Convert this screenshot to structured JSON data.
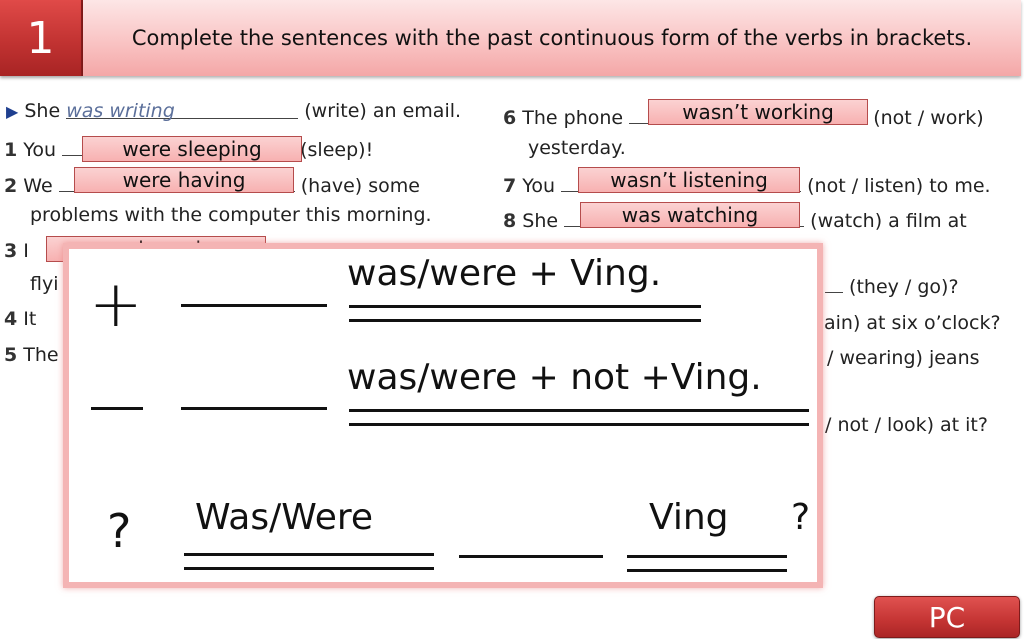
{
  "header": {
    "exercise_number": "1",
    "title": "Complete the sentences with the past continuous form of the verbs in brackets."
  },
  "exercise": {
    "example": {
      "prefix": "She",
      "answer": "was writing",
      "suffix": "(write) an email."
    },
    "items": [
      {
        "num": "1",
        "prefix": "You",
        "answer": "were sleeping",
        "suffix": "(sleep)!"
      },
      {
        "num": "2",
        "prefix": "We",
        "answer": "were having",
        "suffix": "(have) some",
        "line2": "problems with the computer this morning."
      },
      {
        "num": "3",
        "prefix": "I",
        "answer_partial": "was dreaming",
        "line2": "flyi"
      },
      {
        "num": "4",
        "prefix": "It"
      },
      {
        "num": "5",
        "prefix": "The"
      },
      {
        "num": "6",
        "prefix": "The phone",
        "answer": "wasn’t working",
        "suffix": "(not / work)",
        "line2": "yesterday."
      },
      {
        "num": "7",
        "prefix": "You",
        "answer": "wasn’t listening",
        "suffix": "(not / listen) to me."
      },
      {
        "num": "8",
        "prefix": "She",
        "answer": "was watching",
        "suffix": "(watch) a film at"
      }
    ],
    "right_fragments": [
      "(they / go)?",
      "ain) at six o’clock?",
      "/ wearing) jeans",
      "/ not / look) at it?"
    ]
  },
  "rules": {
    "affirmative": {
      "symbol": "+",
      "formula": "was/were + Ving."
    },
    "negative": {
      "symbol": "−",
      "formula": "was/were + not +Ving."
    },
    "question": {
      "symbol": "?",
      "aux": "Was/Were",
      "verb": "Ving",
      "end": "?"
    }
  },
  "footer": {
    "button_label": "PC"
  }
}
